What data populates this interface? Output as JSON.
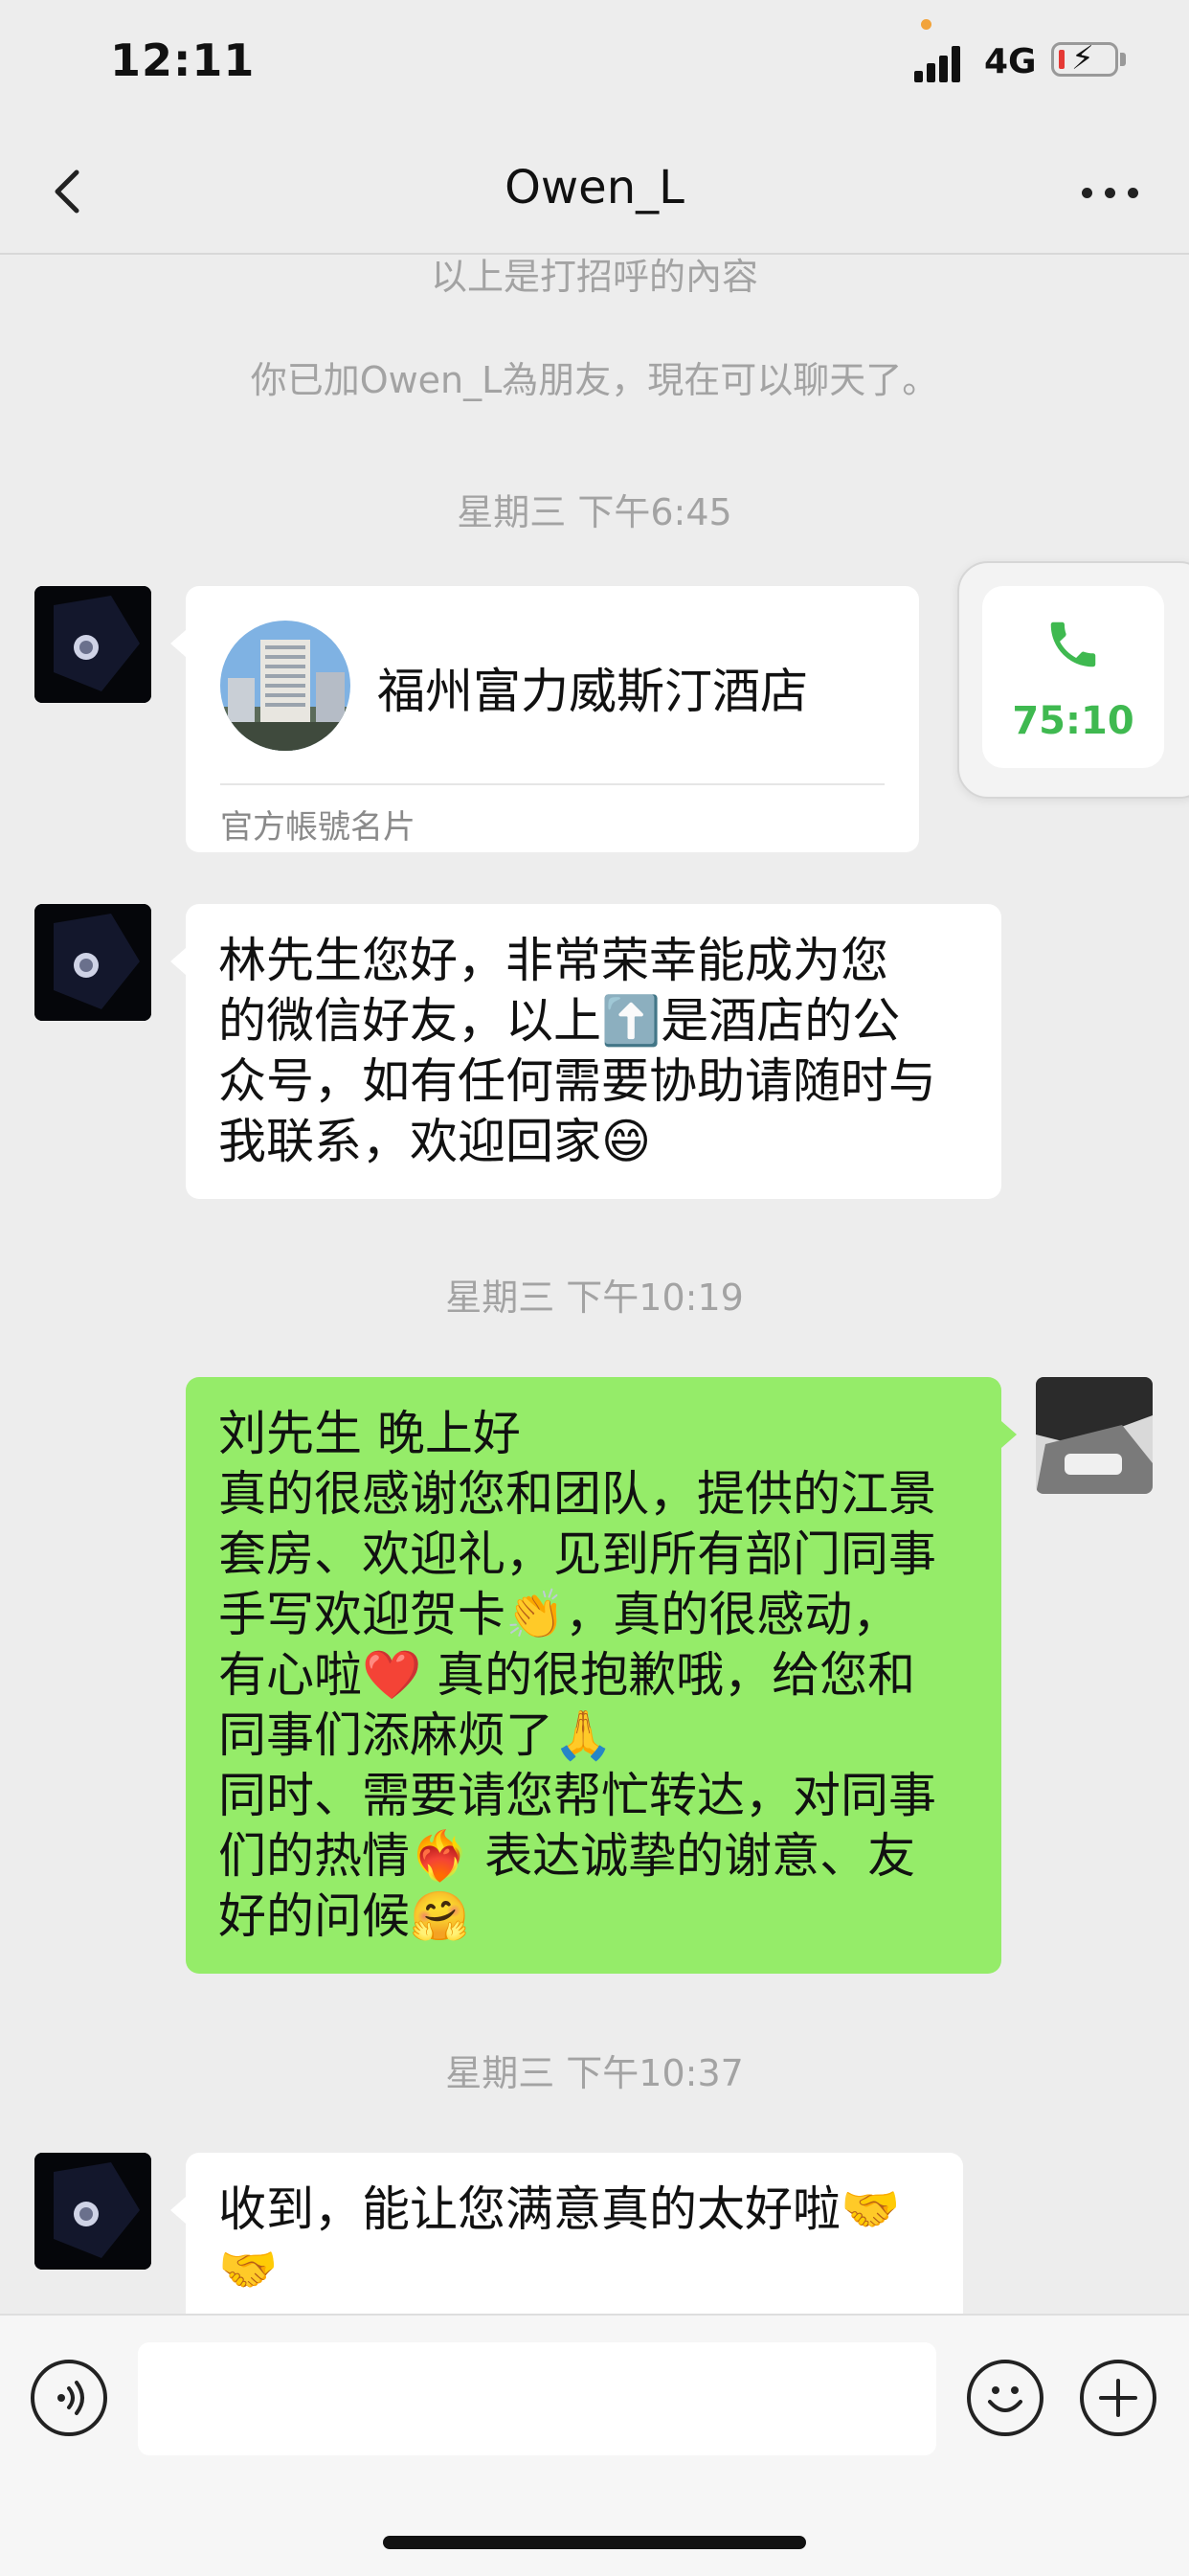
{
  "status_bar": {
    "time": "12:11",
    "network": "4G"
  },
  "header": {
    "title": "Owen_L"
  },
  "messages": {
    "sys_greeting": "以上是打招呼的內容",
    "sys_added": "你已加Owen_L為朋友，現在可以聊天了。",
    "ts1": "星期三 下午6:45",
    "card": {
      "name": "福州富力威斯汀酒店",
      "label": "官方帳號名片"
    },
    "msg1": "林先生您好，非常荣幸能成为您\n的微信好友，以上⬆️是酒店的公\n众号，如有任何需要协助请随时与\n我联系，欢迎回家😄",
    "ts2": "星期三 下午10:19",
    "msg2": "刘先生 晚上好\n真的很感谢您和团队，提供的江景\n套房、欢迎礼，见到所有部门同事\n手写欢迎贺卡👏，真的很感动，\n有心啦❤️ 真的很抱歉哦，给您和\n同事们添麻烦了🙏\n同时、需要请您帮忙转达，对同事\n们的热情❤️‍🔥 表达诚挚的谢意、友\n好的问候🤗",
    "ts3": "星期三 下午10:37",
    "msg3": "收到，能让您满意真的太好啦🤝\n🤝"
  },
  "call_float": {
    "duration": "75:10",
    "icon": "phone-icon"
  },
  "input_bar": {
    "placeholder": ""
  },
  "colors": {
    "self_bubble": "#95ec69",
    "accent_green": "#3fb950",
    "background": "#ededed"
  }
}
